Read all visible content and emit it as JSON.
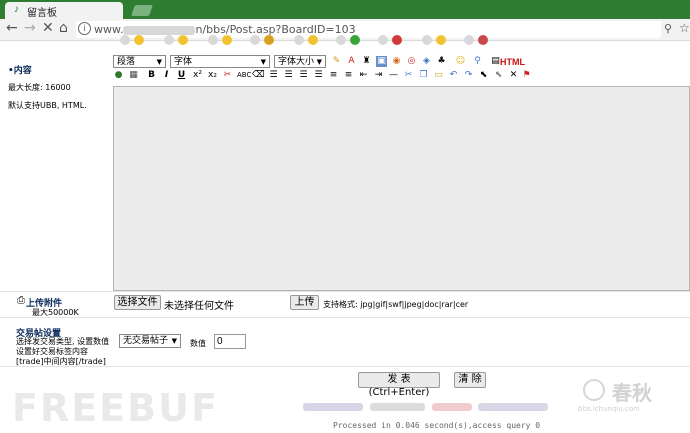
{
  "browser": {
    "tab_title": "留言板",
    "url_prefix": "www.",
    "url_path": "n/bbs/Post.asp?BoardID=103"
  },
  "form": {
    "content_label": "•内容",
    "max_length": "最大长度: 16000",
    "default_support": "默认支持UBB, HTML.",
    "format_select": "段落",
    "font_select": "字体",
    "size_select": "字体大小",
    "html_label": "HTML",
    "upload_label": "上传附件",
    "upload_max": "最大50000K",
    "choose_file_button": "选择文件",
    "no_file_text": "未选择任何文件",
    "upload_button": "上传",
    "supported_formats": "支持格式: jpg|gif|swf|jpeg|doc|rar|cer",
    "trade_title": "交易帖设置",
    "trade_desc1": "选择发交易类型, 设置数值",
    "trade_desc2": "设置好交易标签内容",
    "trade_desc3": "[trade]中间内容[/trade]",
    "trade_select": "无交易帖子",
    "value_label": "数值",
    "value_input": "0",
    "submit_button": "发 表 (Ctrl+Enter)",
    "clear_button": "清 除"
  },
  "footer": {
    "processed": "Processed in 0.046 second(s),access query 0"
  },
  "watermark": {
    "left": "FREEBUF",
    "right_cn": "春秋",
    "right_en": "bbs.ichunqiu.com"
  }
}
